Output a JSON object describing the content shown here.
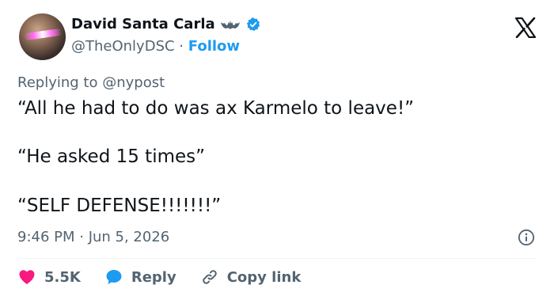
{
  "author": {
    "display_name": "David Santa Carla",
    "handle": "@TheOnlyDSC",
    "separator": "·",
    "follow_label": "Follow"
  },
  "tweet": {
    "reply_prefix": "Replying to",
    "reply_mention": "@nypost",
    "lines": [
      "“All he had to do was ax Karmelo to leave!”",
      "“He asked 15 times”",
      "“SELF DEFENSE!!!!!!!”"
    ],
    "timestamp": "9:46 PM · Jun 5, 2026"
  },
  "actions": {
    "like_count": "5.5K",
    "reply_label": "Reply",
    "copy_link_label": "Copy link"
  },
  "icons": {
    "avatar": "avatar-photo",
    "bat": "bat-icon",
    "verified": "verified-badge-icon",
    "x_logo": "x-logo-icon",
    "info": "info-icon",
    "heart": "heart-icon",
    "reply": "reply-bubble-icon",
    "link": "link-icon"
  },
  "colors": {
    "accent": "#1d9bf0",
    "heart": "#f91880",
    "text": "#0f1419",
    "muted": "#536471"
  }
}
